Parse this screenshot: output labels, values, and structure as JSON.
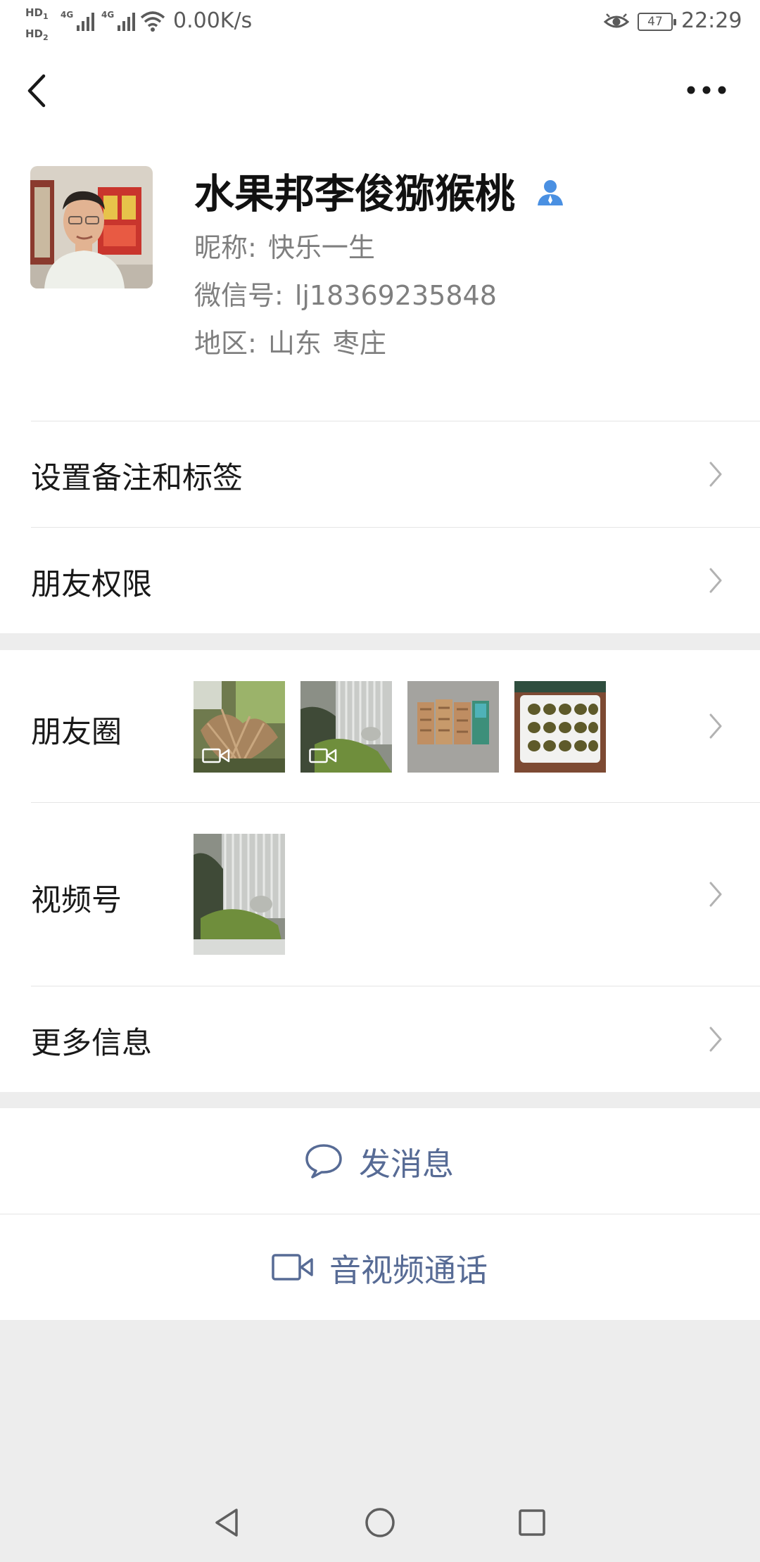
{
  "status_bar": {
    "hd1": "HD",
    "hd2": "HD",
    "net1": "4G",
    "net2": "4G",
    "speed": "0.00K/s",
    "battery": "47",
    "time": "22:29",
    "icons": [
      "hd-icon",
      "signal-icon",
      "wifi-icon",
      "eye-icon",
      "battery-icon"
    ]
  },
  "header": {
    "back_icon": "chevron-left-icon",
    "more_icon": "more-dots-icon"
  },
  "profile": {
    "name": "水果邦李俊猕猴桃",
    "nickname_label": "昵称:",
    "nickname": "快乐一生",
    "wechat_id_label": "微信号:",
    "wechat_id": "lj18369235848",
    "region_label": "地区:",
    "region_province": "山东",
    "region_city": "枣庄"
  },
  "rows": {
    "remark": "设置备注和标签",
    "permissions": "朋友权限",
    "moments": "朋友圈",
    "channels": "视频号",
    "more_info": "更多信息"
  },
  "actions": {
    "message": "发消息",
    "call": "音视频通话"
  },
  "colors": {
    "link_blue": "#576b95",
    "background": "#ededed",
    "contact_icon_blue": "#4a90e2"
  }
}
